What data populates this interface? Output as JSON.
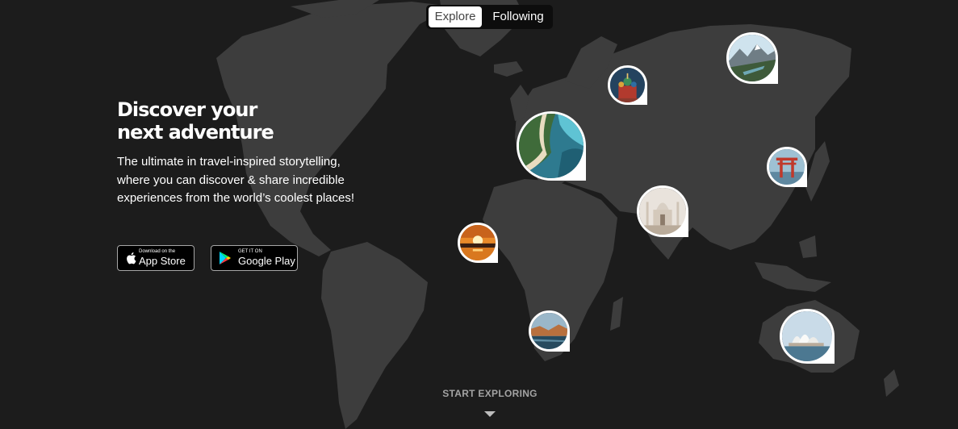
{
  "tabs": {
    "explore": "Explore",
    "following": "Following",
    "active": "Explore"
  },
  "hero": {
    "title_line1": "Discover your",
    "title_line2": "next adventure",
    "description": "The ultimate in travel-inspired storytelling, where you can discover & share incredible experiences from the world’s coolest places!"
  },
  "app_store": {
    "small": "Download on the",
    "big": "App Store",
    "icon": "apple-icon"
  },
  "google_play": {
    "small": "GET IT ON",
    "big": "Google Play",
    "icon": "google-play-icon"
  },
  "cta": {
    "label": "START EXPLORING",
    "icon": "chevron-down-icon"
  },
  "colors": {
    "background": "#1c1c1c",
    "land": "#3d3d3d",
    "accent": "#ffffff"
  }
}
